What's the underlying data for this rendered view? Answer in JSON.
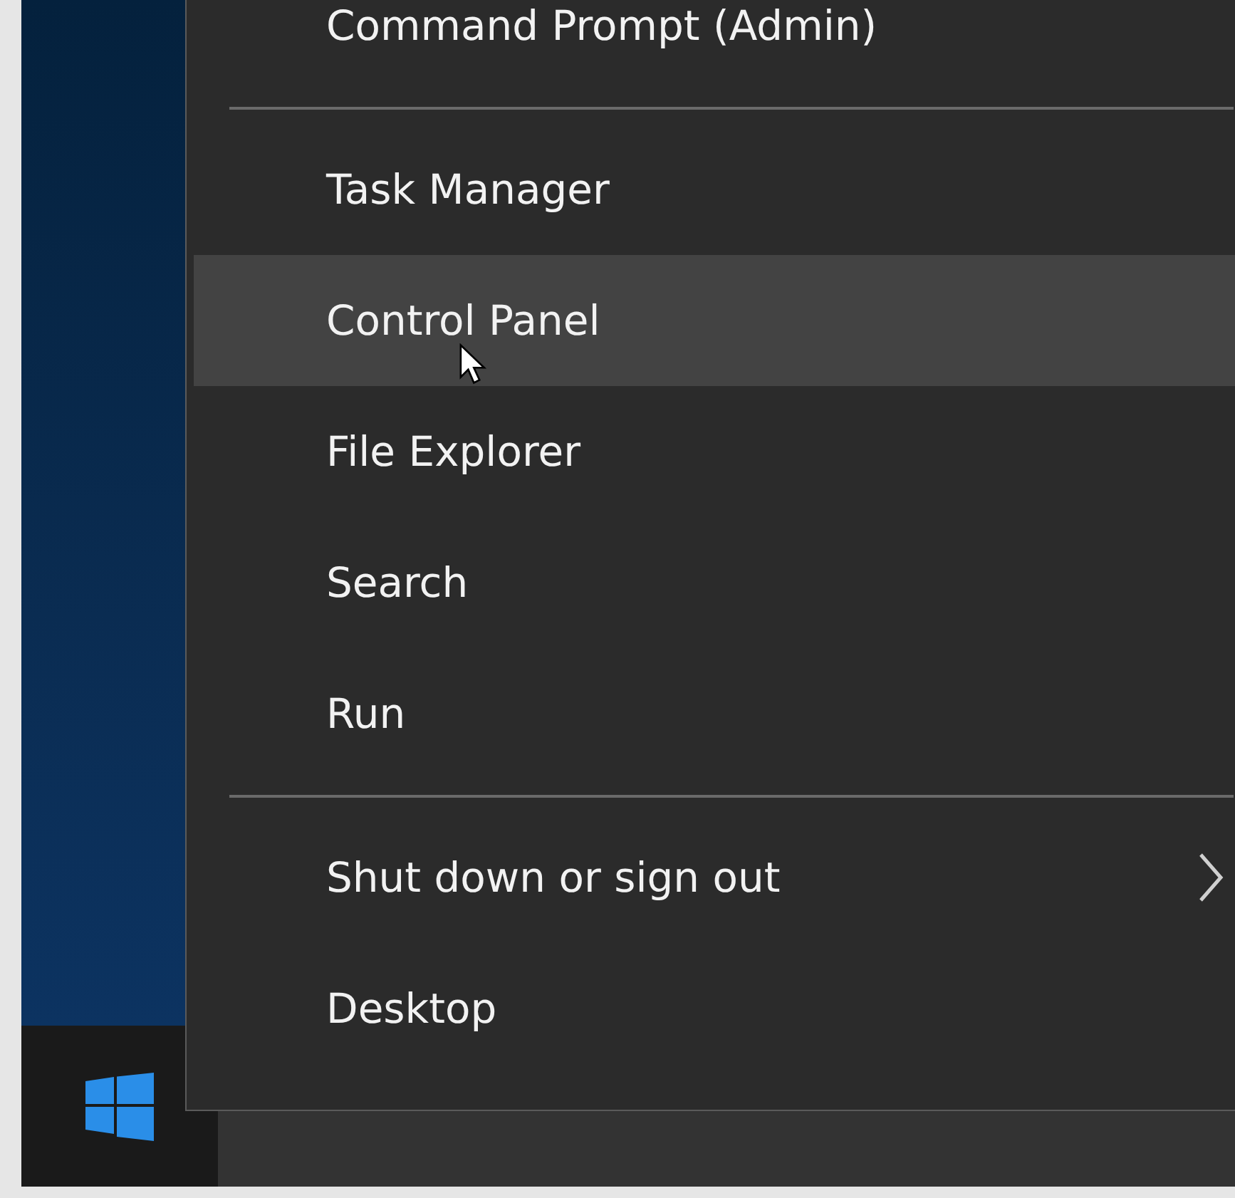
{
  "menu": {
    "items": [
      {
        "kind": "item",
        "label": "Command Prompt (Admin)",
        "selected": false
      },
      {
        "kind": "separator"
      },
      {
        "kind": "item",
        "label": "Task Manager",
        "selected": false
      },
      {
        "kind": "item",
        "label": "Control Panel",
        "selected": true
      },
      {
        "kind": "item",
        "label": "File Explorer",
        "selected": false
      },
      {
        "kind": "item",
        "label": "Search",
        "selected": false
      },
      {
        "kind": "item",
        "label": "Run",
        "selected": false
      },
      {
        "kind": "separator"
      },
      {
        "kind": "submenu",
        "label": "Shut down or sign out",
        "selected": false
      },
      {
        "kind": "item",
        "label": "Desktop",
        "selected": false
      }
    ]
  }
}
